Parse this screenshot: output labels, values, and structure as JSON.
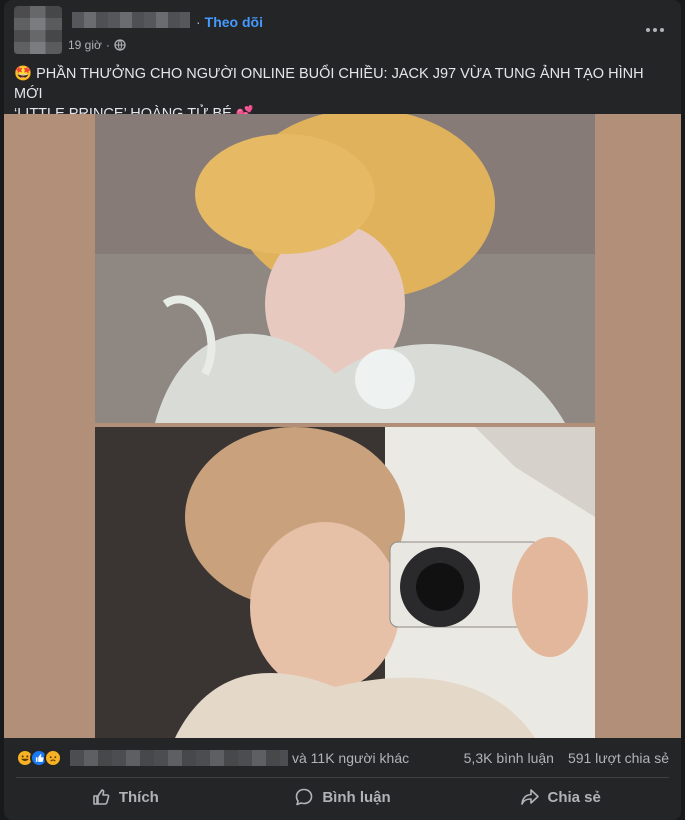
{
  "post": {
    "follow_label": "Theo dõi",
    "time": "19 giờ",
    "caption_line1": "🤩 PHẦN THƯỞNG CHO NGƯỜI ONLINE BUỔI CHIỀU: JACK J97 VỪA TUNG ẢNH TẠO HÌNH MỚI",
    "caption_line2": "‘LITTLE PRINCE’ HOÀNG TỬ BÉ 💕"
  },
  "stats": {
    "others": "và 11K người khác",
    "comments": "5,3K bình luận",
    "shares": "591 lượt chia sẻ"
  },
  "actions": {
    "like": "Thích",
    "comment": "Bình luận",
    "share": "Chia sẻ"
  },
  "icons": [
    "globe-icon",
    "more-icon",
    "haha-reaction-icon",
    "like-reaction-icon",
    "sad-reaction-icon",
    "thumbs-up-icon",
    "comment-icon",
    "share-icon"
  ],
  "colors": {
    "background": "#242526",
    "accent": "#4599ff",
    "muted": "#b0b3b8",
    "media_bg": "#b28f78"
  }
}
